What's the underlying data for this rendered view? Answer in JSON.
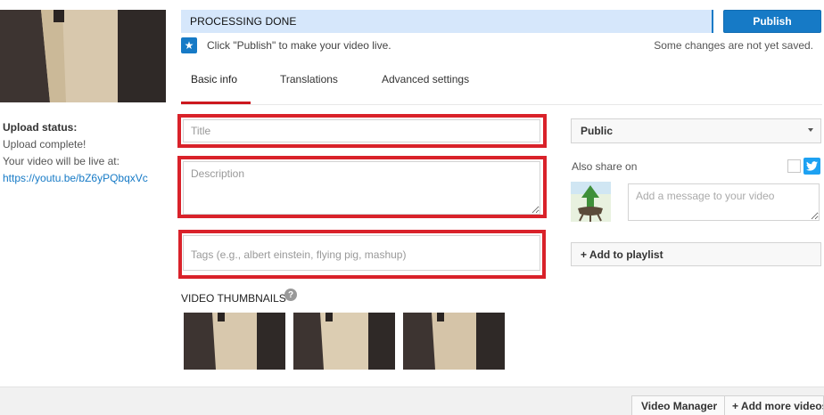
{
  "status": {
    "processing_label": "PROCESSING DONE",
    "publish_label": "Publish",
    "hint": "Click \"Publish\" to make your video live.",
    "unsaved": "Some changes are not yet saved."
  },
  "tabs": [
    {
      "label": "Basic info",
      "active": true
    },
    {
      "label": "Translations",
      "active": false
    },
    {
      "label": "Advanced settings",
      "active": false
    }
  ],
  "upload": {
    "status_label": "Upload status:",
    "status_value": "Upload complete!",
    "live_label": "Your video will be live at:",
    "url": "https://youtu.be/bZ6yPQbqxVc"
  },
  "form": {
    "title_placeholder": "Title",
    "description_placeholder": "Description",
    "tags_placeholder": "Tags (e.g., albert einstein, flying pig, mashup)"
  },
  "thumbnails": {
    "label": "VIDEO THUMBNAILS",
    "help_glyph": "?",
    "count": 3
  },
  "sidebar": {
    "privacy_value": "Public",
    "share_label": "Also share on",
    "message_placeholder": "Add a message to your video",
    "add_playlist_label": "+ Add to playlist"
  },
  "footer": {
    "video_manager_label": "Video Manager",
    "add_more_label": "+ Add more videos"
  },
  "colors": {
    "accent_blue": "#167ac6",
    "highlight_red": "#d9222a",
    "tab_active_red": "#cc181e",
    "progress_bg": "#d6e7fb",
    "twitter_blue": "#1da1f2"
  },
  "icons": {
    "star": "star-icon",
    "help": "help-icon",
    "twitter": "twitter-icon",
    "caret": "caret-down-icon"
  }
}
